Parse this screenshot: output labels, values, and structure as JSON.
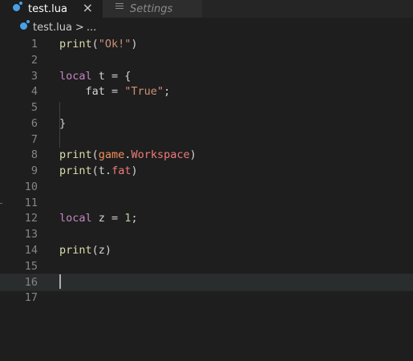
{
  "tabs": [
    {
      "label": "test.lua",
      "active": true,
      "icon": "lua-icon"
    },
    {
      "label": "Settings",
      "active": false,
      "icon": "settings-icon"
    }
  ],
  "tab_close_symbol": "×",
  "breadcrumb": {
    "file": "test.lua",
    "separator": ">",
    "more": "..."
  },
  "editor": {
    "lines": [
      {
        "n": "1",
        "tokens": [
          [
            "fn",
            "print"
          ],
          [
            "punc",
            "("
          ],
          [
            "str",
            "\"Ok!\""
          ],
          [
            "punc",
            ")"
          ]
        ]
      },
      {
        "n": "2",
        "tokens": []
      },
      {
        "n": "3",
        "tokens": [
          [
            "kw",
            "local"
          ],
          [
            "var",
            " t "
          ],
          [
            "punc",
            "= {"
          ]
        ]
      },
      {
        "n": "4",
        "tokens": [
          [
            "var",
            "    fat "
          ],
          [
            "punc",
            "= "
          ],
          [
            "str",
            "\"True\""
          ],
          [
            "punc",
            ";"
          ]
        ]
      },
      {
        "n": "5",
        "tokens": []
      },
      {
        "n": "6",
        "tokens": [
          [
            "punc",
            "}"
          ]
        ]
      },
      {
        "n": "7",
        "tokens": []
      },
      {
        "n": "8",
        "tokens": [
          [
            "fn",
            "print"
          ],
          [
            "punc",
            "("
          ],
          [
            "global",
            "game"
          ],
          [
            "punc",
            "."
          ],
          [
            "prop",
            "Workspace"
          ],
          [
            "punc",
            ")"
          ]
        ]
      },
      {
        "n": "9",
        "tokens": [
          [
            "fn",
            "print"
          ],
          [
            "punc",
            "("
          ],
          [
            "var",
            "t"
          ],
          [
            "punc",
            "."
          ],
          [
            "prop",
            "fat"
          ],
          [
            "punc",
            ")"
          ]
        ]
      },
      {
        "n": "10",
        "tokens": []
      },
      {
        "n": "11",
        "tokens": []
      },
      {
        "n": "12",
        "tokens": [
          [
            "kw",
            "local"
          ],
          [
            "var",
            " z "
          ],
          [
            "punc",
            "= "
          ],
          [
            "num",
            "1"
          ],
          [
            "punc",
            ";"
          ]
        ]
      },
      {
        "n": "13",
        "tokens": []
      },
      {
        "n": "14",
        "tokens": [
          [
            "fn",
            "print"
          ],
          [
            "punc",
            "("
          ],
          [
            "var",
            "z"
          ],
          [
            "punc",
            ")"
          ]
        ]
      },
      {
        "n": "15",
        "tokens": []
      },
      {
        "n": "16",
        "tokens": [],
        "current": true
      },
      {
        "n": "17",
        "tokens": []
      }
    ]
  },
  "colors": {
    "background": "#1e1e1e",
    "keyword": "#c586c0",
    "function": "#dcdcaa",
    "string": "#ce9178",
    "number": "#b5cea8",
    "global": "#f2915a",
    "property": "#f07a7a",
    "line_number": "#858585"
  }
}
